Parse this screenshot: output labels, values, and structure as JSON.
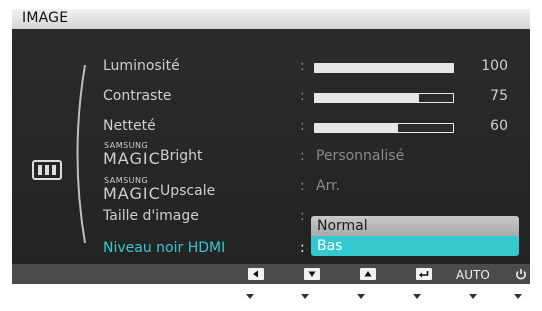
{
  "title": "IMAGE",
  "items": {
    "luminosite": {
      "label": "Luminosité",
      "value": "100",
      "level": 1.0
    },
    "contraste": {
      "label": "Contraste",
      "value": "75",
      "level": 0.75
    },
    "nettete": {
      "label": "Netteté",
      "value": "60",
      "level": 0.6
    },
    "magic_bright": {
      "brand_top": "SAMSUNG",
      "brand_main": "MAGIC",
      "suffix": "Bright",
      "value": "Personnalisé"
    },
    "magic_upscale": {
      "brand_top": "SAMSUNG",
      "brand_main": "MAGIC",
      "suffix": "Upscale",
      "value": "Arr."
    },
    "taille_image": {
      "label": "Taille d'image"
    },
    "niveau_noir": {
      "label": "Niveau noir HDMI",
      "selected": "Bas"
    }
  },
  "colon": ":",
  "dropdown": {
    "options": [
      "Normal",
      "Bas"
    ]
  },
  "bottom_bar": {
    "buttons": [
      "left-arrow-icon",
      "down-arrow-icon",
      "up-arrow-icon",
      "enter-icon",
      "AUTO",
      "power-icon"
    ],
    "auto_label": "AUTO"
  },
  "colors": {
    "accent": "#36c8d0",
    "selected_option": "#33c9cf",
    "background": "#2b2b2b"
  }
}
